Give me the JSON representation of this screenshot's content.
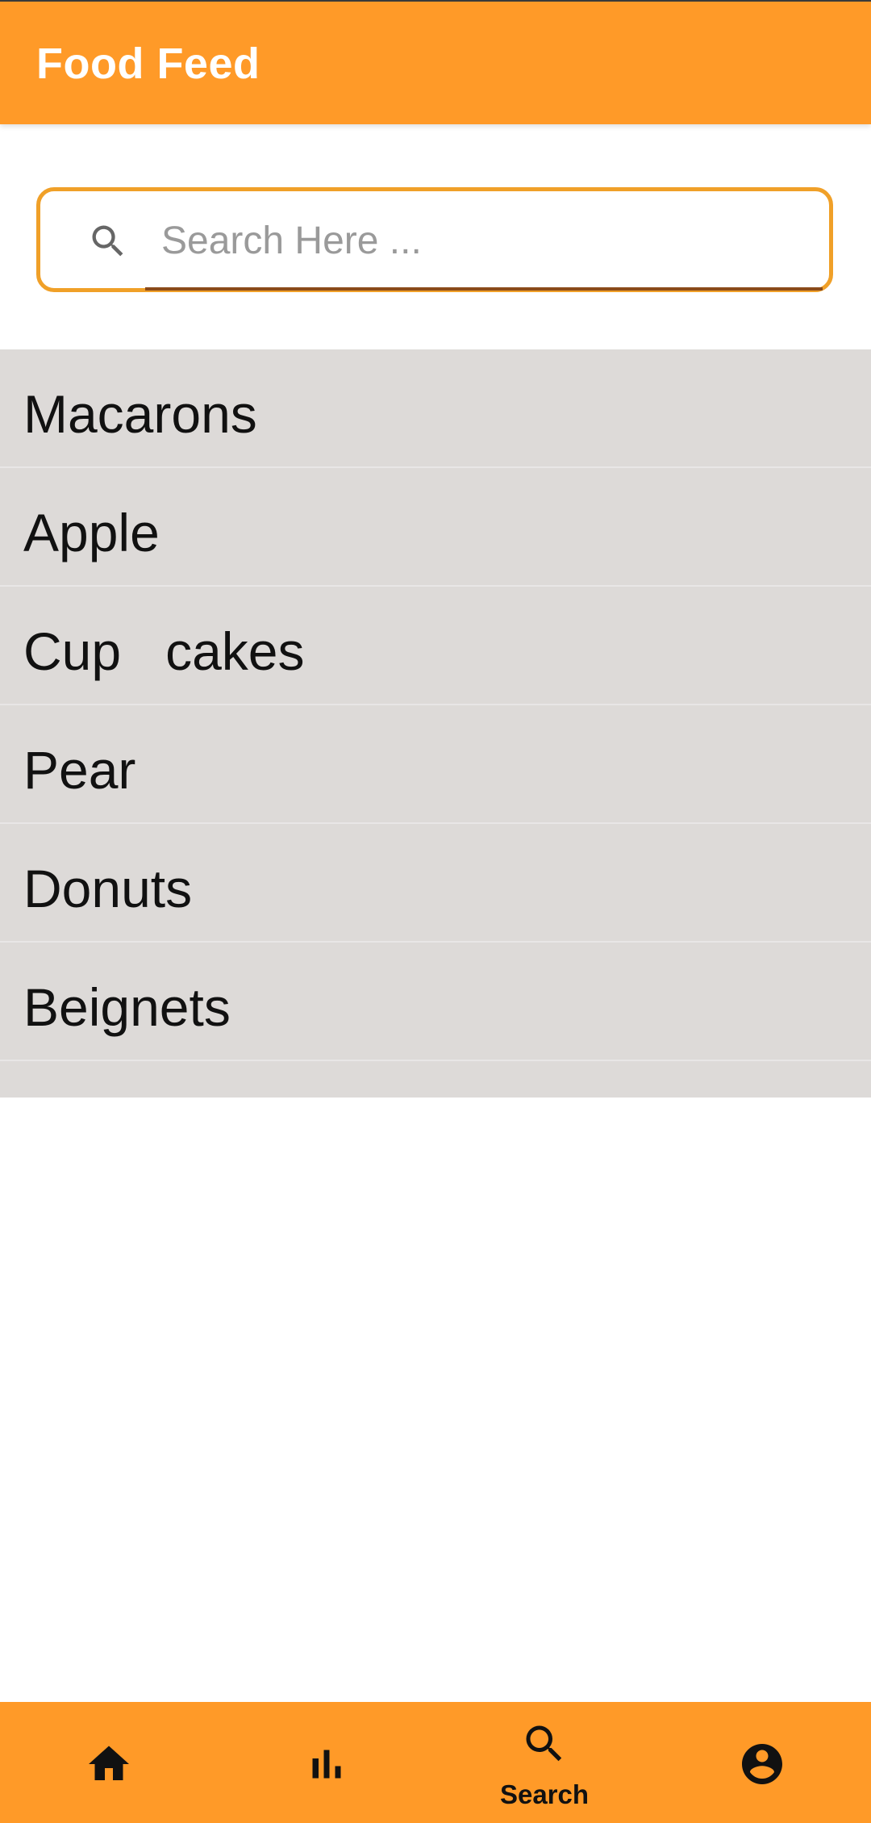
{
  "app_bar": {
    "title": "Food Feed",
    "color": "#FF9A28"
  },
  "search": {
    "placeholder": "Search Here ...",
    "value": "",
    "icon": "search-icon"
  },
  "list": {
    "background": "#DDDAD8",
    "items": [
      {
        "label": "Macarons"
      },
      {
        "label": "Apple"
      },
      {
        "label": "Cup   cakes"
      },
      {
        "label": "Pear"
      },
      {
        "label": "Donuts"
      },
      {
        "label": "Beignets"
      }
    ]
  },
  "bottom_nav": {
    "items": [
      {
        "icon": "home-icon",
        "label": ""
      },
      {
        "icon": "bar-chart-icon",
        "label": ""
      },
      {
        "icon": "search-icon",
        "label": "Search",
        "active": true
      },
      {
        "icon": "account-circle-icon",
        "label": ""
      }
    ]
  }
}
